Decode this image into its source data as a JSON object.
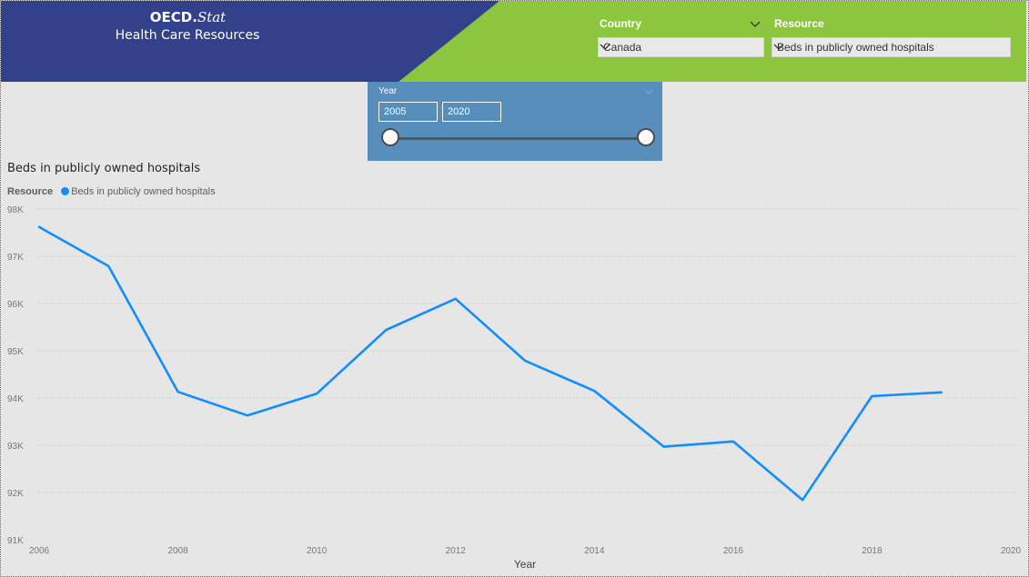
{
  "header": {
    "brand_bold": "OECD.",
    "brand_italic": "Stat",
    "subtitle": "Health Care Resources",
    "colors": {
      "left": "#33418a",
      "right": "#8cc63f"
    }
  },
  "filters": {
    "country": {
      "label": "Country",
      "value": "Canada"
    },
    "resource": {
      "label": "Resource",
      "value": "Beds in publicly owned hospitals"
    }
  },
  "year_slicer": {
    "label": "Year",
    "start": "2005",
    "end": "2020"
  },
  "chart_data": {
    "type": "line",
    "title": "Beds in publicly owned hospitals",
    "legend_title": "Resource",
    "legend_position": "top-left",
    "xlabel": "Year",
    "ylabel": "",
    "xlim": [
      2006,
      2020
    ],
    "ylim": [
      91000,
      98000
    ],
    "x_ticks": [
      "2006",
      "2008",
      "2010",
      "2012",
      "2014",
      "2016",
      "2018",
      "2020"
    ],
    "y_ticks": [
      "98K",
      "97K",
      "96K",
      "95K",
      "94K",
      "93K",
      "92K",
      "91K"
    ],
    "grid": "horizontal dotted",
    "series": [
      {
        "name": "Beds in publicly owned hospitals",
        "color": "#118dff",
        "x": [
          2006,
          2007,
          2008,
          2009,
          2010,
          2011,
          2012,
          2013,
          2014,
          2015,
          2016,
          2017,
          2018,
          2019
        ],
        "values": [
          97620,
          96790,
          94130,
          93630,
          94090,
          95440,
          96100,
          94790,
          94150,
          92970,
          93080,
          91840,
          94040,
          94120
        ]
      }
    ]
  }
}
